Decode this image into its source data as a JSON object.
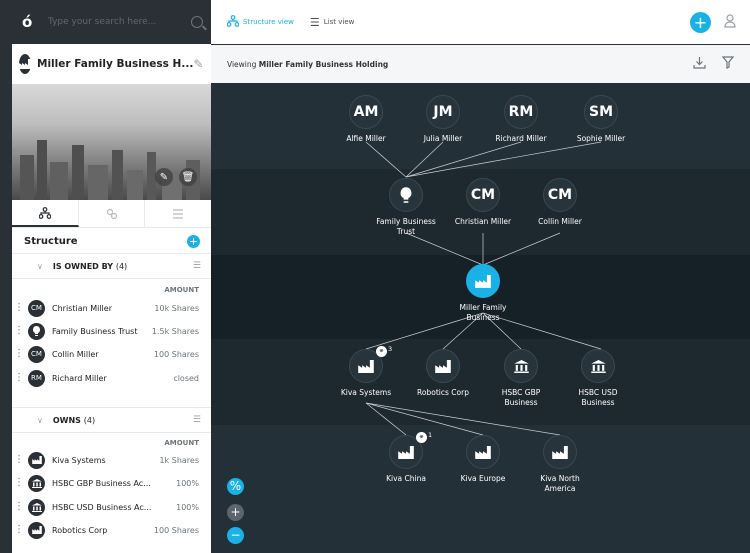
{
  "search": {
    "placeholder": "Type your search here..."
  },
  "company": {
    "name": "Miller Family Business H..."
  },
  "sidebar": {
    "structure_title": "Structure",
    "owned_by": {
      "label": "IS OWNED BY",
      "count": "(4)",
      "amount_header": "AMOUNT",
      "rows": [
        {
          "initials": "CM",
          "name": "Christian Miller",
          "value": "10k Shares"
        },
        {
          "initials": "",
          "name": "Family Business Trust",
          "value": "1.5k Shares"
        },
        {
          "initials": "CM",
          "name": "Collin Miller",
          "value": "100 Shares"
        },
        {
          "initials": "RM",
          "name": "Richard Miller",
          "value": "closed"
        }
      ]
    },
    "owns": {
      "label": "OWNS",
      "count": "(4)",
      "amount_header": "AMOUNT",
      "rows": [
        {
          "name": "Kiva Systems",
          "value": "1k Shares"
        },
        {
          "name": "HSBC GBP Business Ac...",
          "value": "100%"
        },
        {
          "name": "HSBC USD Business Ac...",
          "value": "100%"
        },
        {
          "name": "Robotics Corp",
          "value": "100 Shares"
        }
      ]
    }
  },
  "topbar": {
    "structure_view": "Structure view",
    "list_view": "List view"
  },
  "viewbar": {
    "prefix": "Viewing",
    "name": "Miller Family Business Holding"
  },
  "graph": {
    "row1": [
      {
        "initials": "AM",
        "label": "Alfie Miller"
      },
      {
        "initials": "JM",
        "label": "Julia Miller"
      },
      {
        "initials": "RM",
        "label": "Richard Miller"
      },
      {
        "initials": "SM",
        "label": "Sophie Miller"
      }
    ],
    "row2": [
      {
        "initials": "",
        "label": "Family Business Trust"
      },
      {
        "initials": "CM",
        "label": "Christian Miller"
      },
      {
        "initials": "CM",
        "label": "Collin Miller"
      }
    ],
    "center": {
      "label": "Miller Family Business"
    },
    "row4": [
      {
        "label": "Kiva Systems",
        "badge": "3"
      },
      {
        "label": "Robotics Corp"
      },
      {
        "label": "HSBC GBP Business"
      },
      {
        "label": "HSBC USD Business"
      }
    ],
    "row5": [
      {
        "label": "Kiva China",
        "badge": "1"
      },
      {
        "label": "Kiva Europe"
      },
      {
        "label": "Kiva North America"
      }
    ]
  },
  "zoom": {
    "fit": "%",
    "in": "+",
    "out": "−"
  },
  "colors": {
    "accent": "#1ab2e6",
    "dark": "#2b3036",
    "canvas": "#243038"
  }
}
